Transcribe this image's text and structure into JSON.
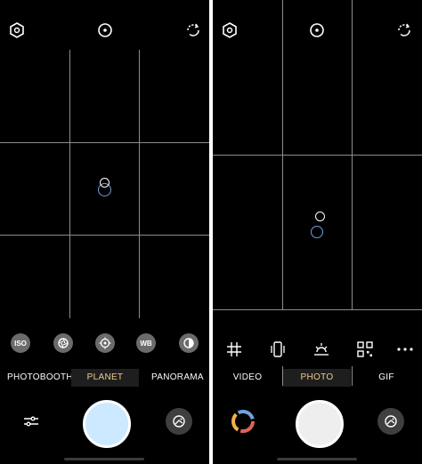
{
  "colors": {
    "background": "#000000",
    "grid_line": "#8c8c8c",
    "active_mode": "#f2c98a",
    "left_shutter": "#cde9ff",
    "right_shutter": "#eeeeee",
    "focus_blue": "#6f9fd8",
    "mode_icon_bg": "#6b6b6b"
  },
  "left_screen": {
    "top_icons": [
      "settings-hexagon-icon",
      "target-icon",
      "rotate-camera-icon"
    ],
    "mode_icons": [
      {
        "name": "iso-icon",
        "label": "ISO"
      },
      {
        "name": "aperture-icon",
        "label": ""
      },
      {
        "name": "focus-target-icon",
        "label": ""
      },
      {
        "name": "white-balance-icon",
        "label": "WB"
      },
      {
        "name": "exposure-icon",
        "label": ""
      }
    ],
    "modes": [
      "PHOTOBOOTH",
      "PLANET",
      "PANORAMA"
    ],
    "active_mode": "PLANET",
    "bottom_left_icon": "sliders-icon",
    "bottom_right_icon": "gallery-icon"
  },
  "right_screen": {
    "top_icons": [
      "settings-hexagon-icon",
      "target-icon",
      "rotate-camera-icon"
    ],
    "tool_icons": [
      "grid-icon",
      "vibrate-icon",
      "sunrise-icon",
      "qr-code-icon",
      "more-icon"
    ],
    "modes": [
      "VIDEO",
      "PHOTO",
      "GIF"
    ],
    "active_mode": "PHOTO",
    "bottom_left_icon": "filter-ring-icon",
    "bottom_right_icon": "gallery-icon"
  }
}
